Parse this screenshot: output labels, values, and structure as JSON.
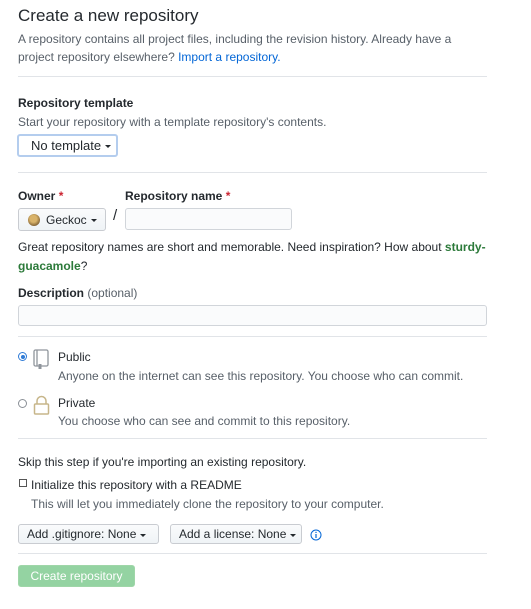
{
  "header": {
    "title": "Create a new repository",
    "intro": "A repository contains all project files, including the revision history. Already have a project repository elsewhere?",
    "import_link": "Import a repository."
  },
  "template": {
    "label": "Repository template",
    "note": "Start your repository with a template repository's contents.",
    "button": "No template"
  },
  "owner": {
    "label": "Owner",
    "required_mark": "*",
    "value": "Geckoc",
    "separator": "/"
  },
  "repo_name": {
    "label": "Repository name",
    "required_mark": "*",
    "value": ""
  },
  "suggestion": {
    "text": "Great repository names are short and memorable. Need inspiration? How about",
    "name": "sturdy-guacamole",
    "name_part1": "sturdy-",
    "name_part2": "guacamole",
    "end": "?"
  },
  "description": {
    "label": "Description",
    "optional": "(optional)",
    "value": ""
  },
  "visibility": {
    "public": {
      "label": "Public",
      "note": "Anyone on the internet can see this repository. You choose who can commit.",
      "selected": true
    },
    "private": {
      "label": "Private",
      "note": "You choose who can see and commit to this repository.",
      "selected": false
    }
  },
  "import_note": "Skip this step if you're importing an existing repository.",
  "readme": {
    "label": "Initialize this repository with a README",
    "note": "This will let you immediately clone the repository to your computer.",
    "checked": false
  },
  "gitignore_button": "Add .gitignore: None",
  "license_button": "Add a license: None",
  "info_icon": "info-icon",
  "submit_button": "Create repository",
  "colors": {
    "link": "#0366d6",
    "required": "#cb2431",
    "submit_disabled": "#94d3a2",
    "suggestion_name": "#2c7a3a"
  }
}
